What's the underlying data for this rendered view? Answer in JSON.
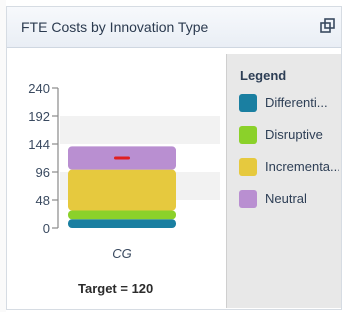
{
  "window": {
    "title": "FTE Costs by Innovation Type",
    "popout_icon": "popout-icon"
  },
  "legend": {
    "title": "Legend",
    "items": [
      {
        "label": "Differenti...",
        "color": "#1a7fa1"
      },
      {
        "label": "Disruptive",
        "color": "#8bd12a"
      },
      {
        "label": "Incrementa...",
        "color": "#e6c93e"
      },
      {
        "label": "Neutral",
        "color": "#b98fd1"
      }
    ]
  },
  "target_text": "Target = 120",
  "chart_data": {
    "type": "bar",
    "stacked": true,
    "categories": [
      "CG"
    ],
    "series": [
      {
        "name": "Differenti...",
        "values": [
          15
        ],
        "color": "#1a7fa1"
      },
      {
        "name": "Disruptive",
        "values": [
          15
        ],
        "color": "#8bd12a"
      },
      {
        "name": "Incrementa...",
        "values": [
          70
        ],
        "color": "#e6c93e"
      },
      {
        "name": "Neutral",
        "values": [
          40
        ],
        "color": "#b98fd1"
      }
    ],
    "ylim": [
      0,
      240
    ],
    "yticks": [
      0,
      48,
      96,
      144,
      192,
      240
    ],
    "target": 120,
    "target_color": "#e02020",
    "grid": true,
    "legend_position": "right"
  }
}
